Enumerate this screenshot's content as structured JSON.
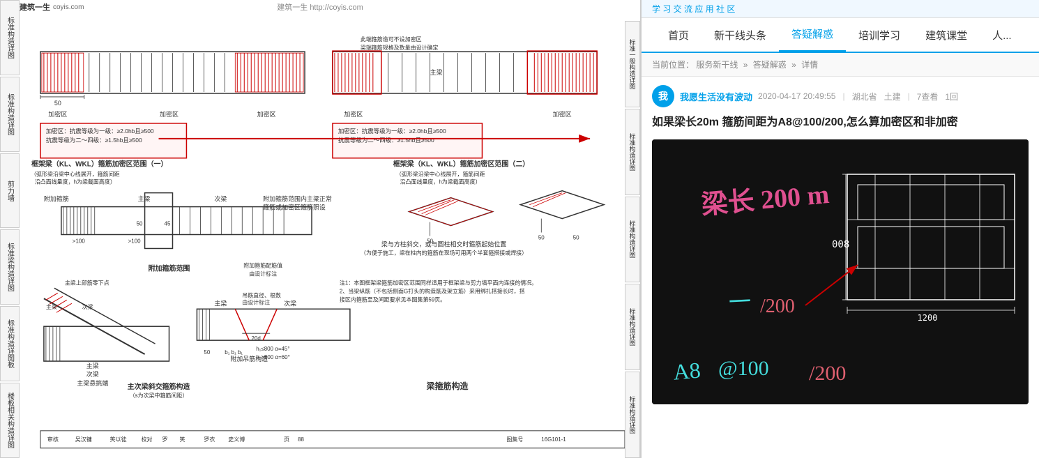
{
  "left_panel": {
    "site_header": "建筑一生  http://coyis.com",
    "logo_text": "建筑一生",
    "logo_sub": "coyis.com",
    "sidebar_labels": [
      "标准构造详图",
      "标准构造详图",
      "标准构造详图",
      "标准构造详图",
      "标准构造详图"
    ],
    "sidebar_labels_right": [
      "标准一般构造详图",
      "标准构造详图",
      "标准构造详图",
      "标准构造详图",
      "标准构造详图"
    ],
    "section_labels": [
      "框架梁（KL、WKL）箍筋加密区范围（一）",
      "框架梁（KL、WKL）箍筋加密区范围（二）",
      "附加箍筋范围",
      "梁与方柱斜交，或与圆柱相交时箍筋起始位置",
      "主次梁斜交箍筋构造",
      "附加吊筋构造",
      "梁箍筋构造"
    ],
    "bottom_labels": [
      "审核",
      "吴汉镛",
      "笑以徒",
      "校对",
      "罗",
      "笑",
      "罗衣",
      "史义博",
      "页",
      "88"
    ],
    "chart_label": "图集号",
    "chart_number": "16G101-1"
  },
  "right_panel": {
    "social_bar_text": "学 习  交 流  应 用 社 区",
    "nav_items": [
      {
        "label": "首页",
        "active": false
      },
      {
        "label": "新干线头条",
        "active": false
      },
      {
        "label": "答疑解惑",
        "active": true
      },
      {
        "label": "培训学习",
        "active": false
      },
      {
        "label": "建筑课堂",
        "active": false
      },
      {
        "label": "人...",
        "active": false
      }
    ],
    "breadcrumb": {
      "items": [
        "当前位置：",
        "服务新干线",
        "答疑解惑",
        "详情"
      ],
      "separators": [
        "»",
        "»"
      ]
    },
    "user": {
      "name": "我愿生活没有波动",
      "date": "2020-04-17 20:49:55",
      "province": "湖北省",
      "job": "土建",
      "views": "7查看",
      "replies": "1回"
    },
    "question_title": "如果梁长20m 箍筋间距为A8@100/200,怎么算加密区和非加密",
    "annotation_text": {
      "beam_length": "梁长 200 m",
      "spacing": "A8@100/200",
      "dimension_1": "008",
      "dimension_2": "1200"
    }
  }
}
